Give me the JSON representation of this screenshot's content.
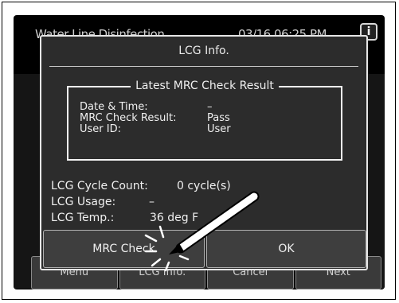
{
  "header": {
    "screen_title": "Water Line Disinfection",
    "datetime": "03/16 06:25 PM",
    "info_icon": "i"
  },
  "nav": {
    "buttons": [
      "Menu",
      "LCG Info.",
      "Cancel",
      "Next"
    ]
  },
  "dialog": {
    "title": "LCG Info.",
    "mrc_section": {
      "heading": "Latest MRC Check Result",
      "rows": [
        {
          "label": "Date & Time:",
          "value": "–"
        },
        {
          "label": "MRC Check Result:",
          "value": "Pass"
        },
        {
          "label": "User ID:",
          "value": "User"
        }
      ]
    },
    "info": [
      {
        "label": "LCG Cycle Count:",
        "value": "0 cycle(s)"
      },
      {
        "label": "LCG Usage:",
        "value": "–"
      },
      {
        "label": "LCG Temp.:",
        "value": "36 deg F"
      }
    ],
    "buttons": {
      "mrc_check": "MRC Check",
      "ok": "OK"
    }
  },
  "annotation": {
    "icon": "stylus-pointer-icon",
    "target": "mrc-check-button"
  },
  "colors": {
    "screen_bg": "#000000",
    "dialog_bg": "#2c2c2c",
    "button_bg": "#3e3e3e",
    "text": "#f0f0f0"
  }
}
